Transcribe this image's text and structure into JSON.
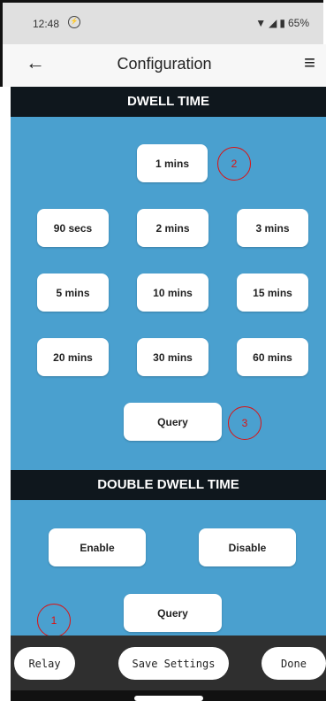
{
  "status": {
    "time": "12:48",
    "battery": "65%"
  },
  "app_bar": {
    "title": "Configuration"
  },
  "dwell": {
    "header": "DWELL TIME",
    "current": "1 mins",
    "options": [
      "90 secs",
      "2 mins",
      "3 mins",
      "5 mins",
      "10 mins",
      "15 mins",
      "20 mins",
      "30 mins",
      "60 mins"
    ],
    "query": "Query"
  },
  "double_dwell": {
    "header": "DOUBLE DWELL TIME",
    "enable": "Enable",
    "disable": "Disable",
    "query": "Query"
  },
  "markers": [
    "1",
    "2",
    "3"
  ],
  "bottom": {
    "relay": "Relay",
    "save": "Save Settings",
    "done": "Done"
  }
}
